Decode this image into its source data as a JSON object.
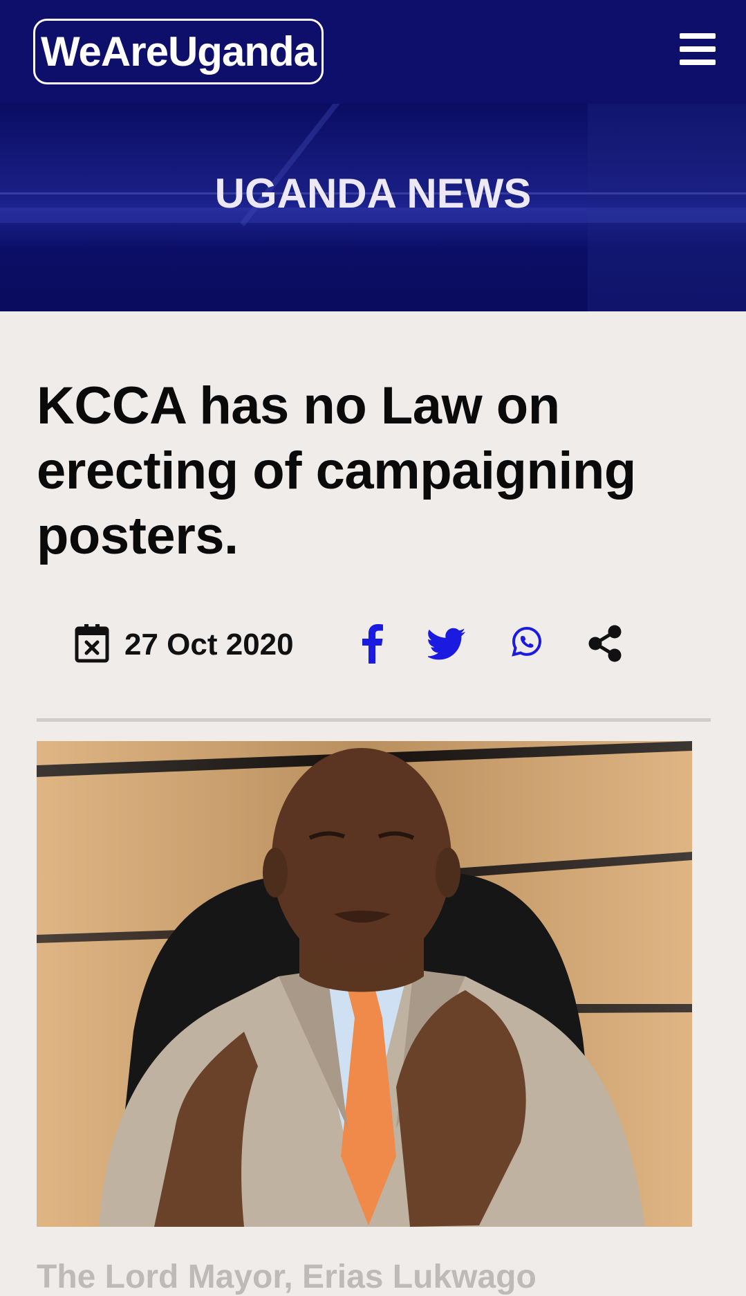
{
  "header": {
    "logo_text": "WeAreUganda",
    "menu_icon": "hamburger-menu-icon",
    "background_color": "#0d0f6a"
  },
  "hero": {
    "title": "UGANDA NEWS"
  },
  "article": {
    "title": "KCCA has no Law on erecting of campaigning posters.",
    "date": "27 Oct 2020",
    "date_icon": "calendar-icon",
    "share_icons": [
      "facebook-icon",
      "twitter-icon",
      "whatsapp-icon",
      "share-icon"
    ],
    "share_colors": {
      "facebook": "#1a1ae0",
      "twitter": "#1a1ae0",
      "whatsapp": "#1a1ae0",
      "share": "#111111"
    },
    "image_alt": "The Lord Mayor, Erias Lukwago",
    "caption_partial": "The Lord Mayor, Erias Lukwago"
  }
}
